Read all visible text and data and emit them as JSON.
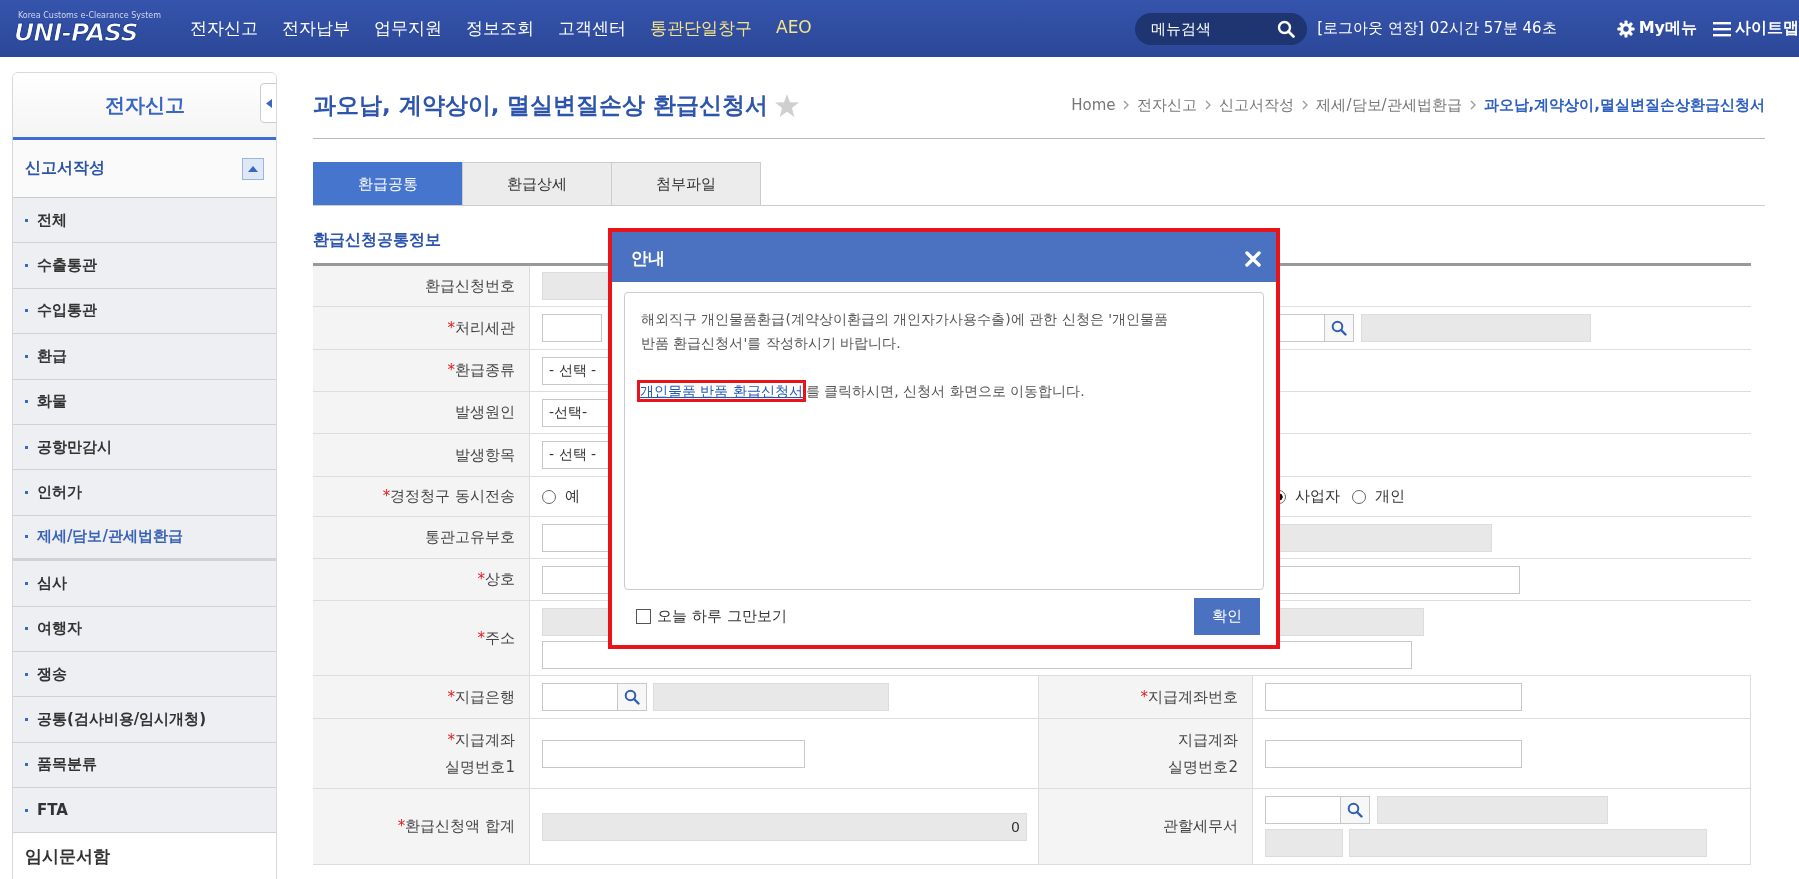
{
  "topbar": {
    "logo": {
      "tagline": "Korea Customs e-Clearance System",
      "name": "UNI-PASS"
    },
    "nav": [
      {
        "label": "전자신고",
        "highlight": false
      },
      {
        "label": "전자납부",
        "highlight": false
      },
      {
        "label": "업무지원",
        "highlight": false
      },
      {
        "label": "정보조회",
        "highlight": false
      },
      {
        "label": "고객센터",
        "highlight": false
      },
      {
        "label": "통관단일창구",
        "highlight": true
      },
      {
        "label": "AEO",
        "highlight": true
      }
    ],
    "search": {
      "placeholder": "메뉴검색"
    },
    "logout_extend": "[로그아웃 연장]",
    "session_time": "02시간 57분 46초",
    "my_menu": "My메뉴",
    "sitemap": "사이트맵"
  },
  "sidebar": {
    "title": "전자신고",
    "section": {
      "label": "신고서작성",
      "expanded": true
    },
    "items": [
      {
        "label": "전체",
        "selected": false
      },
      {
        "label": "수출통관",
        "selected": false
      },
      {
        "label": "수입통관",
        "selected": false
      },
      {
        "label": "환급",
        "selected": false
      },
      {
        "label": "화물",
        "selected": false
      },
      {
        "label": "공항만감시",
        "selected": false
      },
      {
        "label": "인허가",
        "selected": false
      },
      {
        "label": "제세/담보/관세법환급",
        "selected": true
      },
      {
        "label": "심사",
        "selected": false
      },
      {
        "label": "여행자",
        "selected": false
      },
      {
        "label": "쟁송",
        "selected": false
      },
      {
        "label": "공통(검사비용/임시개청)",
        "selected": false
      },
      {
        "label": "품목분류",
        "selected": false
      },
      {
        "label": "FTA",
        "selected": false
      }
    ],
    "next_section": "임시문서함"
  },
  "page": {
    "title": "과오납, 계약상이, 멸실변질손상 환급신청서",
    "breadcrumb": [
      "Home",
      "전자신고",
      "신고서작성",
      "제세/담보/관세법환급",
      "과오납,계약상이,멸실변질손상환급신청서"
    ],
    "tabs": [
      {
        "label": "환급공통",
        "selected": true
      },
      {
        "label": "환급상세",
        "selected": false
      },
      {
        "label": "첨부파일",
        "selected": false
      }
    ],
    "section_title": "환급신청공통정보",
    "rows": [
      {
        "label": "환급신청번호",
        "kind": "readonly"
      },
      {
        "mark": "*",
        "label": "처리세관",
        "kind": "code-search"
      },
      {
        "mark": "*",
        "label": "환급종류",
        "kind": "select",
        "value": "- 선택 -"
      },
      {
        "label": "발생원인",
        "kind": "select",
        "value": "-선택-"
      },
      {
        "label": "발생항목",
        "kind": "select",
        "value": "- 선택 -"
      },
      {
        "mark": "*",
        "label": "경정청구 동시전송",
        "kind": "radios",
        "groups": [
          [
            {
              "label": "예",
              "checked": false
            }
          ],
          [
            {
              "label": "사업자",
              "checked": true
            },
            {
              "label": "개인",
              "checked": false
            }
          ]
        ]
      },
      {
        "label": "통관고유부호",
        "kind": "id"
      },
      {
        "mark": "*",
        "label": "상호",
        "kind": "text"
      },
      {
        "mark": "*",
        "label": "주소",
        "kind": "address"
      },
      {
        "mark": "*",
        "label": "지급은행",
        "kind": "bank",
        "right": {
          "mark": "*",
          "label": "지급계좌번호",
          "kind": "account"
        }
      },
      {
        "mark": "*",
        "label": "지급계좌\n실명번호1",
        "kind": "account",
        "right": {
          "label": "지급계좌\n실명번호2",
          "kind": "account"
        }
      },
      {
        "mark": "*",
        "label": "환급신청액 합계",
        "kind": "total",
        "value": "0",
        "right": {
          "label": "관할세무서",
          "kind": "office"
        }
      }
    ]
  },
  "dialog": {
    "title": "안내",
    "message": "해외직구 개인물품환급(계약상이환급의 개인자가사용수출)에 관한 신청은 '개인물품\n반품 환급신청서'를 작성하시기 바랍니다.",
    "link": "개인물품 반품 환급신청서",
    "link_tail": "를 클릭하시면, 신청서 화면으로 이동합니다.",
    "dont_show_today": {
      "label": "오늘 하루 그만보기",
      "checked": false
    },
    "confirm": "확인"
  }
}
